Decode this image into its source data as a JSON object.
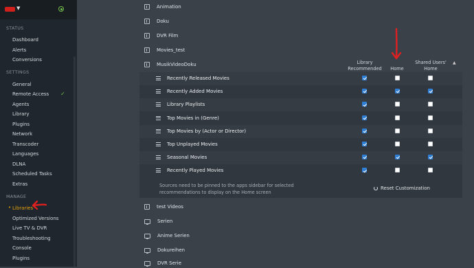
{
  "sidebar": {
    "sections": [
      {
        "label": "STATUS"
      },
      {
        "label": "SETTINGS"
      },
      {
        "label": "MANAGE"
      }
    ],
    "status_items": [
      "Dashboard",
      "Alerts",
      "Conversions"
    ],
    "settings_items": [
      "General",
      "Remote Access",
      "Agents",
      "Library",
      "Plugins",
      "Network",
      "Transcoder",
      "Languages",
      "DLNA",
      "Scheduled Tasks",
      "Extras"
    ],
    "manage_items": [
      "Libraries",
      "Optimized Versions",
      "Live TV & DVR",
      "Troubleshooting",
      "Console",
      "Plugins"
    ],
    "active_item": "Libraries"
  },
  "libraries_top": [
    "Animation",
    "Doku",
    "DVR Film",
    "Movies_test",
    "MusikVideoDoku"
  ],
  "libraries_bottom": [
    {
      "label": "test Videos",
      "icon": "film-icon"
    },
    {
      "label": "Serien",
      "icon": "tv-icon"
    },
    {
      "label": "Anime Serien",
      "icon": "tv-icon"
    },
    {
      "label": "Dokureihen",
      "icon": "tv-icon"
    },
    {
      "label": "DVR Serie",
      "icon": "tv-icon"
    }
  ],
  "columns": {
    "library_recommended": [
      "Library",
      "Recommended"
    ],
    "home": "Home",
    "shared_home": [
      "Shared Users'",
      "Home"
    ]
  },
  "recommendations": [
    {
      "label": "Recently Released Movies",
      "library": true,
      "home": false,
      "shared": false
    },
    {
      "label": "Recently Added Movies",
      "library": true,
      "home": true,
      "shared": true
    },
    {
      "label": "Library Playlists",
      "library": true,
      "home": false,
      "shared": false
    },
    {
      "label": "Top Movies in (Genre)",
      "library": true,
      "home": false,
      "shared": false
    },
    {
      "label": "Top Movies by (Actor or Director)",
      "library": true,
      "home": false,
      "shared": false
    },
    {
      "label": "Top Unplayed Movies",
      "library": true,
      "home": false,
      "shared": false
    },
    {
      "label": "Seasonal Movies",
      "library": true,
      "home": true,
      "shared": true
    },
    {
      "label": "Recently Played Movies",
      "library": true,
      "home": false,
      "shared": false
    }
  ],
  "panel_note": "Sources need to be pinned to the apps sidebar for selected recommendations to display on the Home screen",
  "reset_label": "Reset Customization",
  "colors": {
    "accent": "#e5a00d",
    "checkbox_on": "#2f7fd6",
    "ok": "#74c04a",
    "annotation": "#e02020"
  }
}
